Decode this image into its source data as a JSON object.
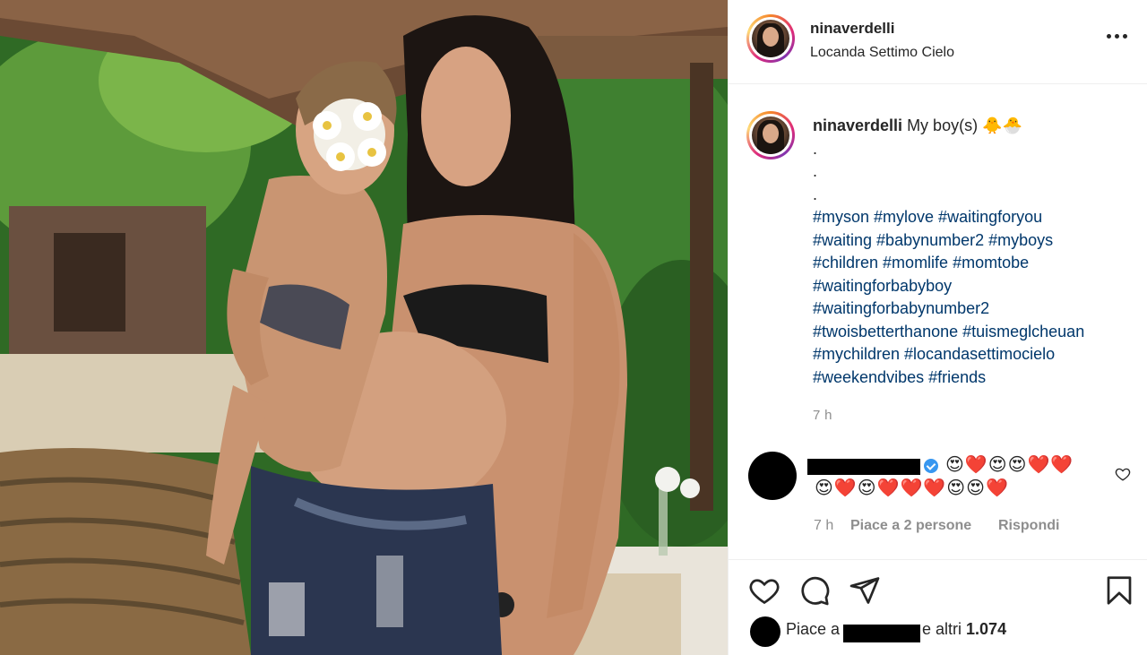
{
  "post": {
    "username": "ninaverdelli",
    "location": "Locanda Settimo Cielo",
    "more_icon": "more-horizontal-icon"
  },
  "caption": {
    "username": "ninaverdelli",
    "text": "My boy(s) 🐥🐣",
    "dots": [
      ".",
      ".",
      "."
    ],
    "hashtags": [
      "#myson #mylove #waitingforyou",
      "#waiting #babynumber2 #myboys",
      "#children #momlife #momtobe",
      "#waitingforbabyboy",
      "#waitingforbabynumber2",
      "#twoisbetterthanone #tuismeglcheuan",
      "#mychildren #locandasettimocielo",
      "#weekendvibes #friends"
    ],
    "time": "7 h"
  },
  "comment": {
    "emoji_line1": "😍❤️😍😍❤️❤️",
    "emoji_line2": "😍❤️😍❤️❤️❤️😍😍❤️",
    "time": "7 h",
    "likes": "Piace a 2 persone",
    "reply": "Rispondi",
    "heart_icon": "heart-outline-icon"
  },
  "actions": {
    "like_icon": "heart-outline-icon",
    "comment_icon": "comment-icon",
    "share_icon": "paper-plane-icon",
    "save_icon": "bookmark-icon"
  },
  "likes": {
    "prefix": "Piace a",
    "suffix": "e altri",
    "count": "1.074"
  },
  "colors": {
    "hashtag": "#00376b",
    "muted": "#8e8e8e",
    "text": "#262626",
    "verified": "#3897f0"
  }
}
